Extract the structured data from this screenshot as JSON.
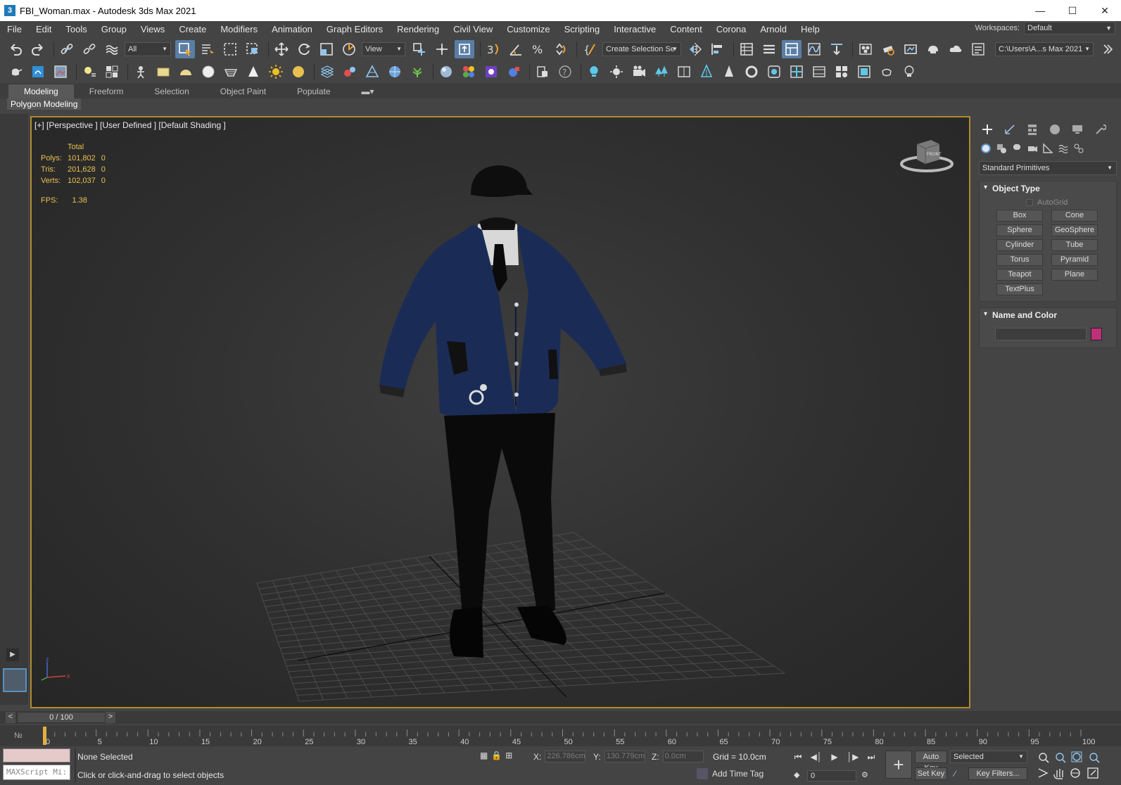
{
  "window": {
    "title": "FBI_Woman.max - Autodesk 3ds Max 2021",
    "app_icon": "3",
    "controls": [
      "minimize-icon",
      "maximize-icon",
      "close-icon"
    ]
  },
  "menu": [
    "File",
    "Edit",
    "Tools",
    "Group",
    "Views",
    "Create",
    "Modifiers",
    "Animation",
    "Graph Editors",
    "Rendering",
    "Civil View",
    "Customize",
    "Scripting",
    "Interactive",
    "Content",
    "Corona",
    "Arnold",
    "Help"
  ],
  "workspaces": {
    "label": "Workspaces:",
    "value": "Default"
  },
  "toolbar1": {
    "selection_filter": "All",
    "ref_coord": "View",
    "named_selection": "Create Selection Se",
    "project_path": "C:\\Users\\A...s Max 2021"
  },
  "ribbon": {
    "tabs": [
      "Modeling",
      "Freeform",
      "Selection",
      "Object Paint",
      "Populate"
    ],
    "active_tab": "Modeling",
    "sub_label": "Polygon Modeling"
  },
  "viewport": {
    "label": "[+] [Perspective ] [User Defined ] [Default Shading ]",
    "stats": {
      "header": "Total",
      "rows": [
        {
          "label": "Polys:",
          "total": "101,802",
          "sel": "0"
        },
        {
          "label": "Tris:",
          "total": "201,628",
          "sel": "0"
        },
        {
          "label": "Verts:",
          "total": "102,037",
          "sel": "0"
        }
      ],
      "fps_label": "FPS:",
      "fps_value": "1.38"
    },
    "viewcube_label": "FRONT",
    "border_color": "#b08a2e"
  },
  "command_panel": {
    "category": "Standard Primitives",
    "object_type": {
      "title": "Object Type",
      "autogrid": "AutoGrid",
      "buttons": [
        "Box",
        "Cone",
        "Sphere",
        "GeoSphere",
        "Cylinder",
        "Tube",
        "Torus",
        "Pyramid",
        "Teapot",
        "Plane",
        "TextPlus"
      ]
    },
    "name_color": {
      "title": "Name and Color",
      "color": "#c0307a"
    }
  },
  "timeline": {
    "slider": "0 / 100",
    "ticks": [
      "0",
      "5",
      "10",
      "15",
      "20",
      "25",
      "30",
      "35",
      "40",
      "45",
      "50",
      "55",
      "60",
      "65",
      "70",
      "75",
      "80",
      "85",
      "90",
      "95",
      "100"
    ]
  },
  "status": {
    "maxscript": "MAXScript Mi:",
    "selection": "None Selected",
    "prompt": "Click or click-and-drag to select objects",
    "x_label": "X:",
    "x_value": "226.786cm",
    "y_label": "Y:",
    "y_value": "130.779cm",
    "z_label": "Z:",
    "z_value": "0.0cm",
    "grid": "Grid = 10.0cm",
    "add_time_tag": "Add Time Tag",
    "frame": "0",
    "auto_key": "Auto Key",
    "set_key": "Set Key",
    "selected": "Selected",
    "key_filters": "Key Filters..."
  }
}
